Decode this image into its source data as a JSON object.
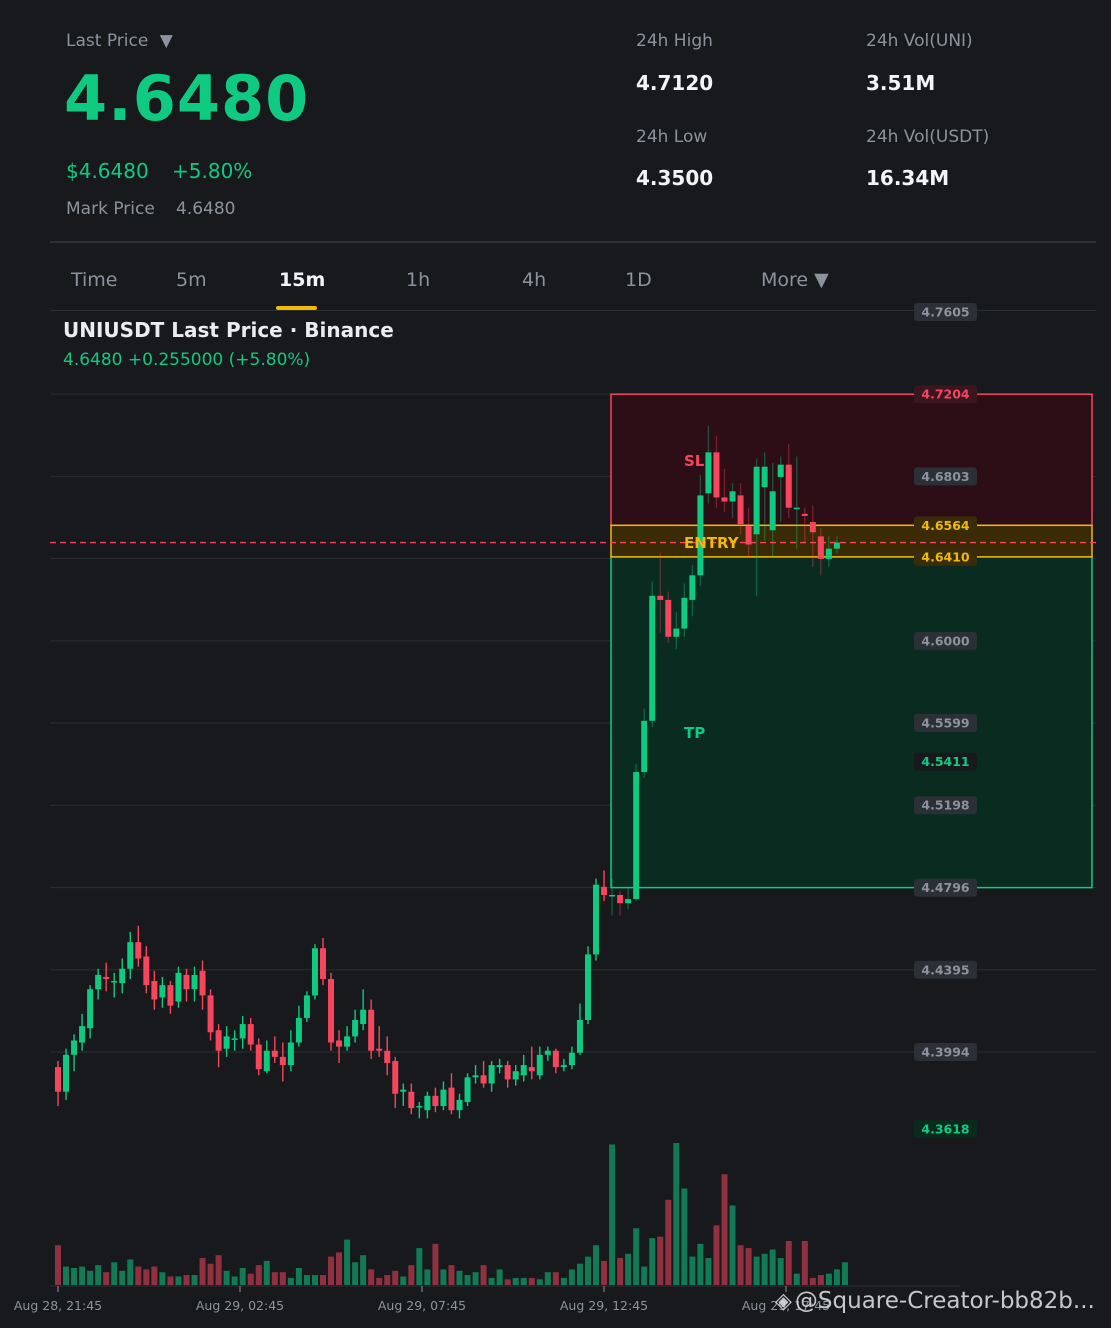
{
  "header": {
    "last_price_label": "Last Price",
    "dropdown_glyph": "▼",
    "last_price": "4.6480",
    "usd_price": "$4.6480",
    "change_pct": "+5.80%",
    "mark_price_label": "Mark Price",
    "mark_price": "4.6480"
  },
  "stats": {
    "high_label": "24h High",
    "high": "4.7120",
    "low_label": "24h Low",
    "low": "4.3500",
    "vol_base_label": "24h Vol(UNI)",
    "vol_base": "3.51M",
    "vol_quote_label": "24h Vol(USDT)",
    "vol_quote": "16.34M"
  },
  "tabs": [
    {
      "label": "Time",
      "active": false
    },
    {
      "label": "5m",
      "active": false
    },
    {
      "label": "15m",
      "active": true
    },
    {
      "label": "1h",
      "active": false
    },
    {
      "label": "4h",
      "active": false
    },
    {
      "label": "1D",
      "active": false
    },
    {
      "label": "More ▼",
      "active": false
    }
  ],
  "chart": {
    "title": "UNIUSDT Last Price · Binance",
    "subtitle": "4.6480  +0.255000 (+5.80%)",
    "watermark": "@Square-Creator-bb82b...",
    "watermark_icon": "binance-logo-icon"
  },
  "chart_data": {
    "type": "candlestick",
    "ylim": [
      4.3618,
      4.7605
    ],
    "y_ticks": [
      "4.7605",
      "4.6803",
      "4.6000",
      "4.5599",
      "4.5198",
      "4.4796",
      "4.4395",
      "4.3994"
    ],
    "x_ticks": [
      "Aug 28, 21:45",
      "Aug 29, 02:45",
      "Aug 29, 07:45",
      "Aug 29, 12:45",
      "Aug 29, 17:45"
    ],
    "gridlines": [
      4.7204,
      4.6803,
      4.6402,
      4.6,
      4.5599,
      4.5198,
      4.4796,
      4.4395,
      4.3994
    ],
    "current_price": 4.648,
    "position": {
      "sl_label": "SL",
      "entry_label": "ENTRY",
      "tp_label": "TP",
      "stop_loss": 4.7204,
      "entry_high": 4.6564,
      "entry_low": 4.641,
      "take_profit": 4.4796
    },
    "price_tags": [
      {
        "text": "4.7204",
        "value": 4.7204,
        "color": "#f6465d"
      },
      {
        "text": "4.6564",
        "value": 4.6564,
        "color": "#f0b90b"
      },
      {
        "text": "4.6410",
        "value": 4.641,
        "color": "#f0b90b"
      },
      {
        "text": "4.5411",
        "value": 4.5411,
        "color": "#0ecb81"
      },
      {
        "text": "4.3618",
        "value": 4.3618,
        "color": "#0ecb81"
      }
    ],
    "colors": {
      "up": "#0ecb81",
      "down": "#f6465d",
      "sl_zone": "#2d0d16",
      "tp_zone": "#0a2b20",
      "entry_zone": "#3a2a06"
    },
    "candles": [
      [
        4.392,
        4.38,
        4.395,
        4.373
      ],
      [
        4.38,
        4.398,
        4.401,
        4.376
      ],
      [
        4.398,
        4.405,
        4.408,
        4.39
      ],
      [
        4.404,
        4.412,
        4.418,
        4.4
      ],
      [
        4.411,
        4.43,
        4.432,
        4.406
      ],
      [
        4.43,
        4.437,
        4.44,
        4.425
      ],
      [
        4.436,
        4.435,
        4.443,
        4.429
      ],
      [
        4.434,
        4.434,
        4.438,
        4.426
      ],
      [
        4.433,
        4.44,
        4.445,
        4.428
      ],
      [
        4.44,
        4.453,
        4.458,
        4.435
      ],
      [
        4.453,
        4.445,
        4.461,
        4.441
      ],
      [
        4.446,
        4.432,
        4.451,
        4.428
      ],
      [
        4.434,
        4.425,
        4.439,
        4.42
      ],
      [
        4.426,
        4.432,
        4.436,
        4.421
      ],
      [
        4.432,
        4.422,
        4.434,
        4.418
      ],
      [
        4.424,
        4.438,
        4.441,
        4.421
      ],
      [
        4.437,
        4.43,
        4.44,
        4.424
      ],
      [
        4.43,
        4.437,
        4.441,
        4.424
      ],
      [
        4.439,
        4.427,
        4.444,
        4.42
      ],
      [
        4.427,
        4.409,
        4.43,
        4.405
      ],
      [
        4.41,
        4.4,
        4.413,
        4.392
      ],
      [
        4.401,
        4.407,
        4.412,
        4.397
      ],
      [
        4.406,
        4.406,
        4.41,
        4.4
      ],
      [
        4.406,
        4.413,
        4.417,
        4.401
      ],
      [
        4.413,
        4.403,
        4.416,
        4.4
      ],
      [
        4.403,
        4.391,
        4.406,
        4.388
      ],
      [
        4.39,
        4.4,
        4.405,
        4.389
      ],
      [
        4.4,
        4.397,
        4.407,
        4.394
      ],
      [
        4.397,
        4.393,
        4.404,
        4.385
      ],
      [
        4.393,
        4.404,
        4.41,
        4.39
      ],
      [
        4.404,
        4.416,
        4.422,
        4.402
      ],
      [
        4.416,
        4.427,
        4.429,
        4.414
      ],
      [
        4.427,
        4.45,
        4.452,
        4.425
      ],
      [
        4.45,
        4.435,
        4.455,
        4.432
      ],
      [
        4.435,
        4.404,
        4.438,
        4.4
      ],
      [
        4.405,
        4.402,
        4.41,
        4.394
      ],
      [
        4.402,
        4.407,
        4.412,
        4.4
      ],
      [
        4.407,
        4.415,
        4.42,
        4.404
      ],
      [
        4.413,
        4.42,
        4.43,
        4.41
      ],
      [
        4.42,
        4.4,
        4.425,
        4.396
      ],
      [
        4.401,
        4.4,
        4.412,
        4.397
      ],
      [
        4.4,
        4.394,
        4.407,
        4.388
      ],
      [
        4.395,
        4.379,
        4.397,
        4.372
      ],
      [
        4.38,
        4.381,
        4.384,
        4.373
      ],
      [
        4.38,
        4.372,
        4.384,
        4.369
      ],
      [
        4.373,
        4.373,
        4.375,
        4.367
      ],
      [
        4.371,
        4.378,
        4.38,
        4.367
      ],
      [
        4.378,
        4.373,
        4.382,
        4.37
      ],
      [
        4.373,
        4.381,
        4.385,
        4.371
      ],
      [
        4.382,
        4.371,
        4.389,
        4.369
      ],
      [
        4.371,
        4.376,
        4.379,
        4.367
      ],
      [
        4.375,
        4.387,
        4.389,
        4.373
      ],
      [
        4.387,
        4.388,
        4.393,
        4.384
      ],
      [
        4.388,
        4.384,
        4.395,
        4.382
      ],
      [
        4.384,
        4.393,
        4.395,
        4.38
      ],
      [
        4.392,
        4.393,
        4.396,
        4.389
      ],
      [
        4.393,
        4.386,
        4.395,
        4.382
      ],
      [
        4.386,
        4.39,
        4.393,
        4.383
      ],
      [
        4.388,
        4.393,
        4.398,
        4.385
      ],
      [
        4.392,
        4.39,
        4.402,
        4.386
      ],
      [
        4.388,
        4.398,
        4.402,
        4.386
      ],
      [
        4.398,
        4.4,
        4.402,
        4.395
      ],
      [
        4.4,
        4.392,
        4.401,
        4.389
      ],
      [
        4.392,
        4.393,
        4.396,
        4.39
      ],
      [
        4.393,
        4.399,
        4.402,
        4.391
      ],
      [
        4.399,
        4.415,
        4.423,
        4.398
      ],
      [
        4.415,
        4.447,
        4.451,
        4.413
      ],
      [
        4.447,
        4.481,
        4.484,
        4.444
      ],
      [
        4.48,
        4.476,
        4.488,
        4.473
      ],
      [
        4.476,
        4.476,
        4.484,
        4.466
      ],
      [
        4.476,
        4.472,
        4.478,
        4.466
      ],
      [
        4.472,
        4.474,
        4.48,
        4.469
      ],
      [
        4.474,
        4.536,
        4.54,
        4.473
      ],
      [
        4.536,
        4.561,
        4.567,
        4.533
      ],
      [
        4.561,
        4.622,
        4.629,
        4.558
      ],
      [
        4.622,
        4.62,
        4.643,
        4.604
      ],
      [
        4.62,
        4.602,
        4.624,
        4.599
      ],
      [
        4.602,
        4.606,
        4.614,
        4.596
      ],
      [
        4.606,
        4.621,
        4.628,
        4.602
      ],
      [
        4.62,
        4.632,
        4.637,
        4.612
      ],
      [
        4.632,
        4.671,
        4.681,
        4.627
      ],
      [
        4.672,
        4.692,
        4.705,
        4.667
      ],
      [
        4.692,
        4.67,
        4.7,
        4.665
      ],
      [
        4.67,
        4.668,
        4.684,
        4.663
      ],
      [
        4.668,
        4.673,
        4.677,
        4.66
      ],
      [
        4.671,
        4.657,
        4.677,
        4.652
      ],
      [
        4.656,
        4.647,
        4.665,
        4.641
      ],
      [
        4.652,
        4.685,
        4.689,
        4.622
      ],
      [
        4.675,
        4.685,
        4.692,
        4.649
      ],
      [
        4.654,
        4.673,
        4.687,
        4.641
      ],
      [
        4.68,
        4.686,
        4.69,
        4.658
      ],
      [
        4.686,
        4.665,
        4.696,
        4.66
      ],
      [
        4.665,
        4.665,
        4.69,
        4.645
      ],
      [
        4.662,
        4.661,
        4.665,
        4.648
      ],
      [
        4.658,
        4.653,
        4.666,
        4.636
      ],
      [
        4.651,
        4.64,
        4.655,
        4.632
      ],
      [
        4.64,
        4.645,
        4.651,
        4.636
      ],
      [
        4.645,
        4.648,
        4.651,
        4.643
      ]
    ],
    "volumes": [
      0.28,
      0.13,
      0.12,
      0.13,
      0.1,
      0.14,
      0.09,
      0.16,
      0.1,
      0.18,
      0.13,
      0.11,
      0.13,
      0.09,
      0.06,
      0.06,
      0.07,
      0.07,
      0.19,
      0.15,
      0.21,
      0.1,
      0.06,
      0.12,
      0.08,
      0.14,
      0.17,
      0.09,
      0.09,
      0.05,
      0.12,
      0.07,
      0.07,
      0.07,
      0.2,
      0.23,
      0.32,
      0.16,
      0.21,
      0.11,
      0.05,
      0.07,
      0.1,
      0.06,
      0.14,
      0.26,
      0.11,
      0.29,
      0.11,
      0.14,
      0.1,
      0.07,
      0.09,
      0.14,
      0.05,
      0.11,
      0.04,
      0.05,
      0.05,
      0.05,
      0.04,
      0.09,
      0.09,
      0.05,
      0.11,
      0.15,
      0.2,
      0.28,
      0.17,
      0.99,
      0.19,
      0.22,
      0.4,
      0.13,
      0.33,
      0.34,
      0.6,
      1.0,
      0.68,
      0.2,
      0.29,
      0.19,
      0.42,
      0.78,
      0.56,
      0.28,
      0.26,
      0.2,
      0.22,
      0.25,
      0.19,
      0.31,
      0.08,
      0.31,
      0.05,
      0.07,
      0.08,
      0.11,
      0.16
    ]
  }
}
